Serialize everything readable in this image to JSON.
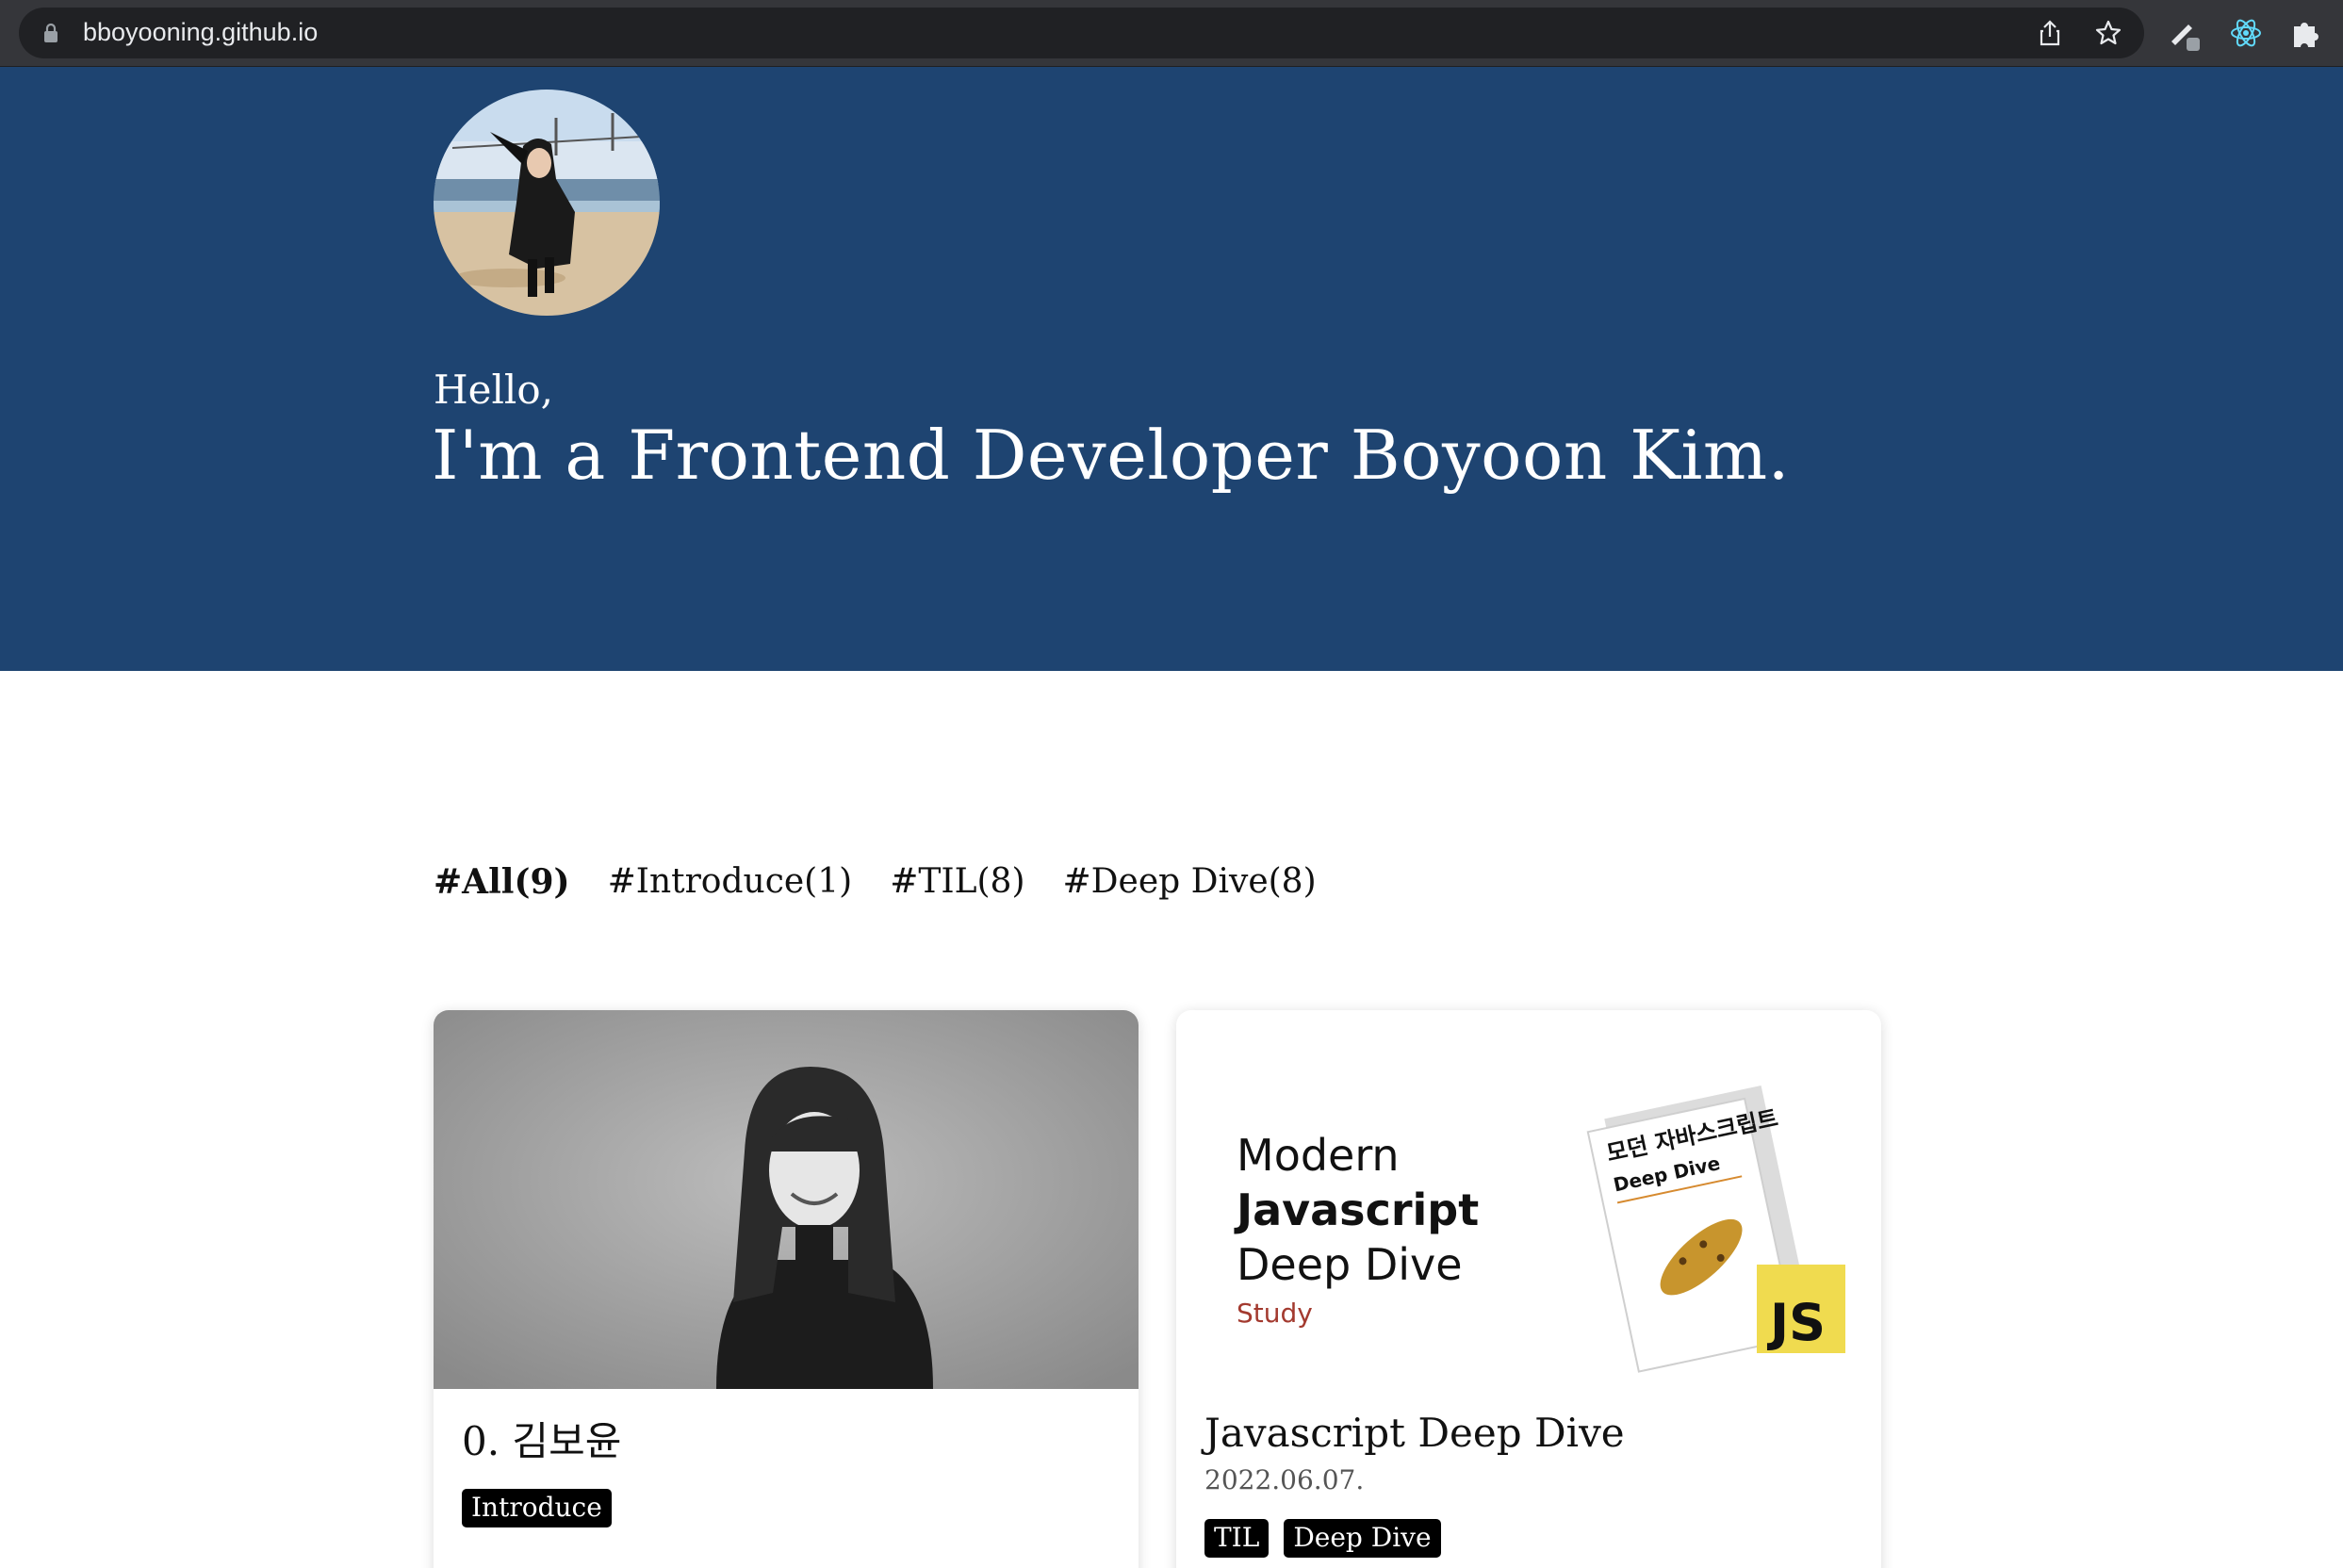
{
  "browser": {
    "url": "bboyooning.github.io"
  },
  "hero": {
    "greeting": "Hello,",
    "headline": "I'm a Frontend Developer Boyoon Kim.",
    "background_color": "#1e4471"
  },
  "filters": [
    {
      "label": "#All(9)",
      "active": true
    },
    {
      "label": "#Introduce(1)",
      "active": false
    },
    {
      "label": "#TIL(8)",
      "active": false
    },
    {
      "label": "#Deep Dive(8)",
      "active": false
    }
  ],
  "posts": [
    {
      "title": "0. 김보윤",
      "date": "",
      "tags": [
        "Introduce"
      ]
    },
    {
      "title": "Javascript Deep Dive",
      "date": "2022.06.07.",
      "tags": [
        "TIL",
        "Deep Dive"
      ],
      "thumbnail": {
        "line1": "Modern",
        "line2": "Javascript",
        "line3": "Deep Dive",
        "subtitle": "Study",
        "book_title_ko": "모던 자바스크립트",
        "book_title_en": "Deep Dive",
        "badge": "JS",
        "badge_color": "#f0db4f"
      }
    }
  ]
}
